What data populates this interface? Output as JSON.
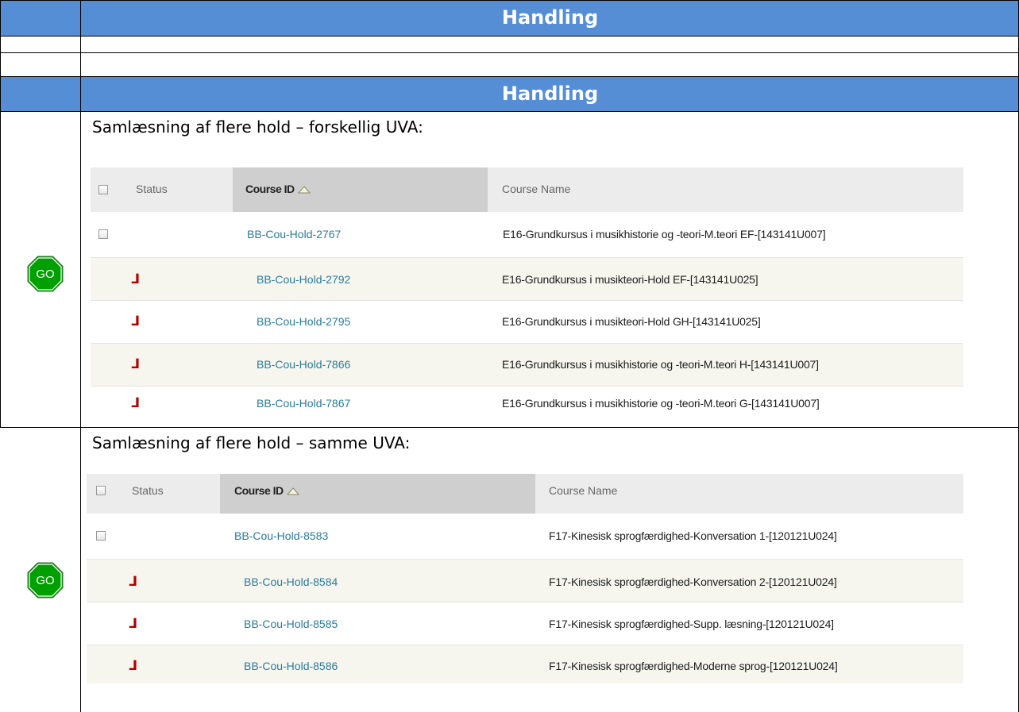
{
  "header": {
    "title": "Handling"
  },
  "header2": {
    "title": "Handling"
  },
  "sections": [
    {
      "title": "Samlæsning af flere hold – forskellig UVA:",
      "go_label": "GO",
      "columns": {
        "status": "Status",
        "course_id": "Course ID",
        "course_name": "Course Name"
      },
      "parent": {
        "course_id": "BB-Cou-Hold-2767",
        "course_name": "E16-Grundkursus i musikhistorie og -teori-M.teori EF-[143141U007]"
      },
      "children": [
        {
          "course_id": "BB-Cou-Hold-2792",
          "course_name": "E16-Grundkursus i musikteori-Hold EF-[143141U025]"
        },
        {
          "course_id": "BB-Cou-Hold-2795",
          "course_name": "E16-Grundkursus i musikteori-Hold GH-[143141U025]"
        },
        {
          "course_id": "BB-Cou-Hold-7866",
          "course_name": "E16-Grundkursus i musikhistorie og -teori-M.teori H-[143141U007]"
        },
        {
          "course_id": "BB-Cou-Hold-7867",
          "course_name": "E16-Grundkursus i musikhistorie og -teori-M.teori G-[143141U007]"
        }
      ]
    },
    {
      "title": "Samlæsning af flere hold – samme UVA:",
      "go_label": "GO",
      "columns": {
        "status": "Status",
        "course_id": "Course ID",
        "course_name": "Course Name"
      },
      "parent": {
        "course_id": "BB-Cou-Hold-8583",
        "course_name": "F17-Kinesisk sprogfærdighed-Konversation 1-[120121U024]"
      },
      "children": [
        {
          "course_id": "BB-Cou-Hold-8584",
          "course_name": "F17-Kinesisk sprogfærdighed-Konversation 2-[120121U024]"
        },
        {
          "course_id": "BB-Cou-Hold-8585",
          "course_name": "F17-Kinesisk sprogfærdighed-Supp. læsning-[120121U024]"
        },
        {
          "course_id": "BB-Cou-Hold-8586",
          "course_name": "F17-Kinesisk sprogfærdighed-Moderne sprog-[120121U024]"
        }
      ]
    }
  ],
  "icons": {
    "go": "stop-sign-go-icon",
    "child": "child-course-arrow-icon",
    "sort": "sort-ascending-triangle-icon"
  },
  "colors": {
    "header_bg": "#558ed5",
    "go_green": "#00a000",
    "link": "#2a7b9b",
    "child_icon": "#b30000"
  }
}
